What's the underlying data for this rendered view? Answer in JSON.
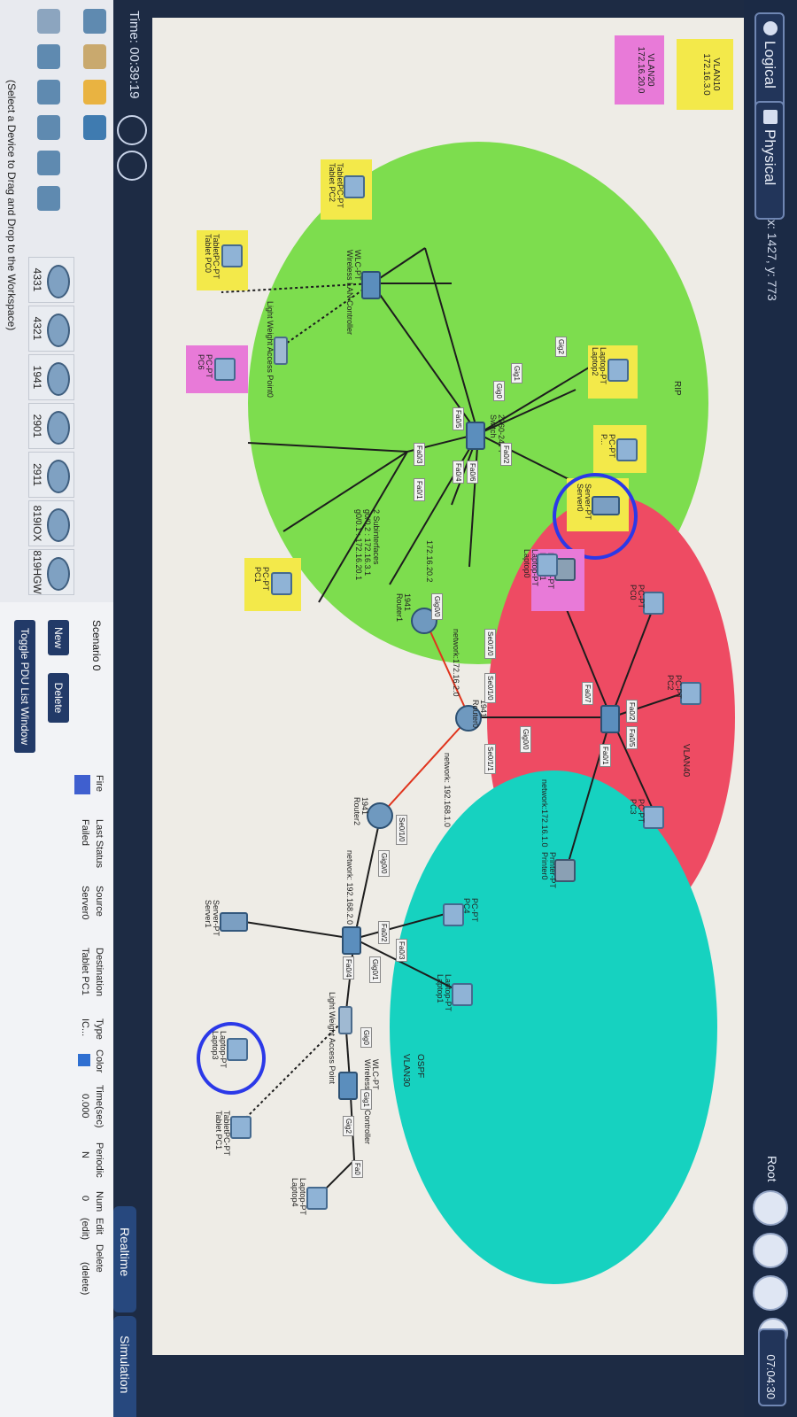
{
  "app": {
    "tabs": {
      "logical": "Logical",
      "physical": "Physical"
    },
    "cursor_readout": "x: 1427, y: 773",
    "root_label": "Root",
    "clock": "07:04:30",
    "timer": "Time: 00:39:19",
    "modes": {
      "realtime": "Realtime",
      "simulation": "Simulation"
    }
  },
  "legend": {
    "vlan10": "VLAN10\n172.16.3.0",
    "vlan20": "VLAN20\n172.16.20.0"
  },
  "zones": {
    "green_protocol": "RIP",
    "red_vlan": "VLAN40",
    "cyan_protocol": "OSPF",
    "cyan_vlan": "VLAN30"
  },
  "networks": {
    "n1": "network:172.16.2.0",
    "n2": "network: 192.168.1.0",
    "n3": "network:172.16.1.0",
    "n4": "network: 192.168.2.0",
    "subnet_ip": "172.16.20.2",
    "subinterfaces": "2 Subinterfaces\ng0/0.2 : 172.16.3.1\ng0/0.1 : 172.16.20.1"
  },
  "devices": {
    "green": [
      {
        "name": "Laptop-PT\nLaptop2"
      },
      {
        "name": "PC-PT\nP..."
      },
      {
        "name": "Server-PT\nServer0"
      },
      {
        "name": "Printer-PT\nPrinter1"
      },
      {
        "name": "2960-24TT\nSwitch"
      },
      {
        "name": "WLC-PT\nWireless LAN Controller"
      },
      {
        "name": "Light Weight Access Point0"
      },
      {
        "name": "TabletPC-PT\nTablet PC2"
      },
      {
        "name": "TabletPC-PT\nTablet PC0"
      },
      {
        "name": "PC-PT\nPC6"
      },
      {
        "name": "PC-PT\nPC1"
      },
      {
        "name": "1941\nRouter1"
      }
    ],
    "red": [
      {
        "name": "Laptop-PT\nLaptop0"
      },
      {
        "name": "PC-PT\nPC0"
      },
      {
        "name": "PC-PT\nPC2"
      },
      {
        "name": "PC-PT\nPC3"
      },
      {
        "name": "Printer-PT\nPrinter0"
      },
      {
        "name": "1941\nRouter0"
      }
    ],
    "cyan": [
      {
        "name": "1941\nRouter2"
      },
      {
        "name": "Server-PT\nServer1"
      },
      {
        "name": "PC-PT\nPC4"
      },
      {
        "name": "Laptop-PT\nLaptop1"
      },
      {
        "name": "Laptop-PT\nLaptop3"
      },
      {
        "name": "Light Weight Access Point"
      },
      {
        "name": "WLC-PT\nWireless LAN Controller"
      },
      {
        "name": "TabletPC-PT\nTablet PC1"
      },
      {
        "name": "Laptop-PT\nLaptop4"
      }
    ]
  },
  "ports": [
    "Fa0",
    "Gig2",
    "Gig1",
    "Gig0",
    "Fa0/2",
    "Fa0/6",
    "Fa0/4",
    "Fa0/5",
    "Fa0/1",
    "Fa0/3",
    "Gig0/1",
    "Gig0/0",
    "Se0/1/0",
    "Se0/1/1",
    "Fa0/7"
  ],
  "device_panel": {
    "models": [
      "4331",
      "4321",
      "1941",
      "2901",
      "2911",
      "819IOX",
      "819HGW"
    ],
    "hint": "(Select a Device to Drag and Drop to the Workspace)"
  },
  "pdu_panel": {
    "scenario": "Scenario 0",
    "new_label": "New",
    "delete_label": "Delete",
    "toggle_label": "Toggle PDU List Window",
    "columns": [
      "Fire",
      "Last Status",
      "Source",
      "Destination",
      "Type",
      "Color",
      "Time(sec)",
      "Periodic",
      "Num",
      "Edit",
      "Delete"
    ],
    "row": {
      "last_status": "Failed",
      "source": "Server0",
      "destination": "Tablet PC1",
      "type": "IC...",
      "time": "0.000",
      "periodic": "N",
      "num": "0",
      "edit": "(edit)",
      "delete": "(delete)"
    }
  },
  "colors": {
    "green_zone": "#7ddd4e",
    "red_zone": "#ee4b63",
    "cyan_zone": "#16d2c0",
    "yellow": "#f3e94a",
    "pink": "#e87ad8",
    "annotation": "#2b39e8"
  }
}
